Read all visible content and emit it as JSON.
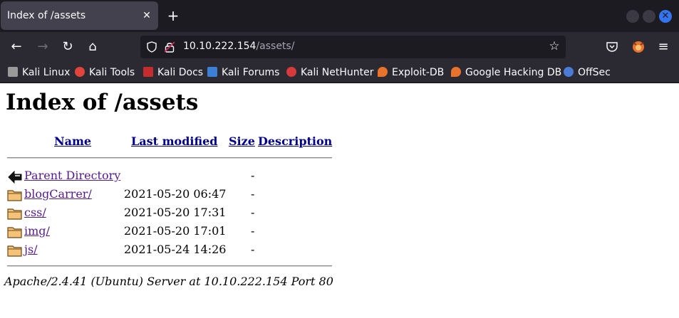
{
  "tab": {
    "title": "Index of /assets",
    "close_glyph": "✕",
    "new_glyph": "+"
  },
  "window": {
    "close_glyph": "✕"
  },
  "nav": {
    "back_glyph": "←",
    "forward_glyph": "→",
    "reload_glyph": "↻",
    "home_glyph": "⌂",
    "url_host": "10.10.222.154",
    "url_path": "/assets/",
    "star_glyph": "☆",
    "menu_glyph": "≡"
  },
  "bookmarks": [
    {
      "label": "Kali Linux",
      "icon": "kali-dragon-icon",
      "color": "#9a9a9a"
    },
    {
      "label": "Kali Tools",
      "icon": "kali-tools-icon",
      "color": "#e0443b"
    },
    {
      "label": "Kali Docs",
      "icon": "kali-docs-icon",
      "color": "#c42d2d"
    },
    {
      "label": "Kali Forums",
      "icon": "kali-forums-icon",
      "color": "#3b7fd6"
    },
    {
      "label": "Kali NetHunter",
      "icon": "kali-nethunter-icon",
      "color": "#d63a3a"
    },
    {
      "label": "Exploit-DB",
      "icon": "exploit-db-icon",
      "color": "#e8732c"
    },
    {
      "label": "Google Hacking DB",
      "icon": "ghdb-icon",
      "color": "#e8732c"
    },
    {
      "label": "OffSec",
      "icon": "offsec-icon",
      "color": "#4a7bd6"
    }
  ],
  "page": {
    "heading": "Index of /assets",
    "columns": {
      "name": "Name",
      "last_modified": "Last modified",
      "size": "Size",
      "description": "Description"
    },
    "rows": [
      {
        "name": "Parent Directory",
        "date": "",
        "size": "-",
        "icon": "back-arrow-icon"
      },
      {
        "name": "blogCarrer/",
        "date": "2021-05-20 06:47",
        "size": "-",
        "icon": "folder-icon"
      },
      {
        "name": "css/",
        "date": "2021-05-20 17:31",
        "size": "-",
        "icon": "folder-icon"
      },
      {
        "name": "img/",
        "date": "2021-05-20 17:01",
        "size": "-",
        "icon": "folder-icon"
      },
      {
        "name": "js/",
        "date": "2021-05-24 14:26",
        "size": "-",
        "icon": "folder-icon"
      }
    ],
    "footer": "Apache/2.4.41 (Ubuntu) Server at 10.10.222.154 Port 80"
  }
}
